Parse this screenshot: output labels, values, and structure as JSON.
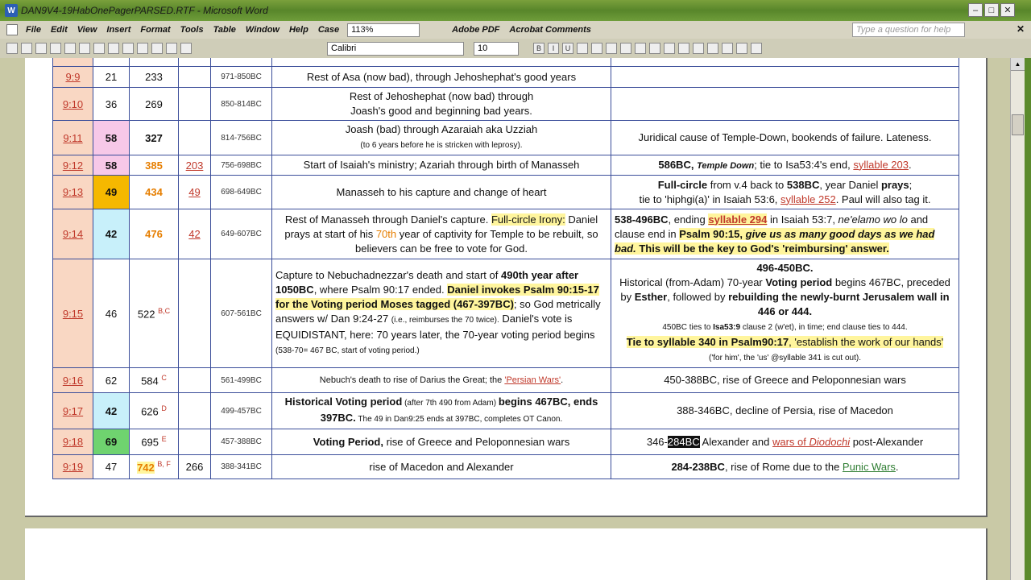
{
  "window": {
    "title": "DAN9V4-19HabOnePagerPARSED.RTF - Microsoft Word",
    "app_icon": "W"
  },
  "menu": {
    "items": [
      "File",
      "Edit",
      "View",
      "Insert",
      "Format",
      "Tools",
      "Table",
      "Window",
      "Help"
    ],
    "case_label": "Case",
    "zoom": "113%",
    "adobe": "Adobe PDF",
    "acrobat": "Acrobat Comments",
    "help_placeholder": "Type a question for help"
  },
  "toolbar": {
    "font": "Calibri",
    "size": "10"
  },
  "rows": [
    {
      "verse": "9:9",
      "c2": "21",
      "c3": "233",
      "c4": "",
      "dates": "971-850BC",
      "desc": "Rest of Asa (now bad), through Jehoshephat's good years",
      "notes": ""
    },
    {
      "verse": "9:10",
      "c2": "36",
      "c3": "269",
      "c4": "",
      "dates": "850-814BC",
      "desc_line1": "Rest of Jehoshephat (now bad) through",
      "desc_line2": "Joash's good and beginning bad years.",
      "notes": ""
    },
    {
      "verse": "9:11",
      "c2": "58",
      "c3": "327",
      "c4": "",
      "dates": "814-756BC",
      "desc_line1": "Joash (bad) through Azaraiah aka Uzziah",
      "desc_line2": "(to 6 years before he is stricken with leprosy).",
      "notes": "Juridical cause of Temple-Down, bookends of failure.  Lateness."
    },
    {
      "verse": "9:12",
      "c2": "58",
      "c3": "385",
      "c4": "203",
      "dates": "756-698BC",
      "desc": "Start of Isaiah's ministry; Azariah through birth of Manasseh",
      "notes_a": "586BC, ",
      "notes_b": "Temple Down",
      "notes_c": "; tie to Isa53:4's end, ",
      "notes_d": "syllable 203",
      "notes_e": "."
    },
    {
      "verse": "9:13",
      "c2": "49",
      "c3": "434",
      "c4": "49",
      "dates": "698-649BC",
      "desc": "Manasseh to his capture and change of heart",
      "notes_l1a": "Full-circle",
      "notes_l1b": " from v.4 back to ",
      "notes_l1c": "538BC",
      "notes_l1d": ", year Daniel ",
      "notes_l1e": "prays",
      "notes_l1f": ";",
      "notes_l2a": "tie to 'hiphgi(a)' in Isaiah 53:6, ",
      "notes_l2b": "syllable 252",
      "notes_l2c": ".  Paul will also tag it."
    },
    {
      "verse": "9:14",
      "c2": "42",
      "c3": "476",
      "c4": "42",
      "dates": "649-607BC",
      "desc_a": "Rest of Manasseh through Daniel's capture. ",
      "desc_b": "Full-circle Irony:",
      "desc_c": " Daniel prays at start of his ",
      "desc_d": "70th",
      "desc_e": " year of captivity for Temple to be rebuilt, so believers can be free to vote for God.",
      "notes_a": "538-496BC",
      "notes_b": ", ending ",
      "notes_c": "syllable 294",
      "notes_d": " in Isaiah 53:7, ",
      "notes_e": "ne'elamo wo lo",
      "notes_f": " and clause end in  ",
      "notes_g": "Psalm 90:15, ",
      "notes_h": "give us as many good days as we had bad.",
      "notes_i": "  This will be the key to God's 'reimbursing' answer."
    },
    {
      "verse": "9:15",
      "c2": "46",
      "c3": "522",
      "c3sup": "B,C",
      "c4": "",
      "dates": "607-561BC",
      "desc_a": "Capture to Nebuchadnezzar's death and start of ",
      "desc_b": "490th year after 1050BC",
      "desc_c": ", where Psalm 90:17 ended.  ",
      "desc_d": "Daniel invokes Psalm 90:15-17 for the Voting period Moses tagged (467-397BC)",
      "desc_e": "; so God metrically answers w/ Dan 9:24-27 ",
      "desc_f": "(i.e., reimburses the 70 twice).",
      "desc_g": " Daniel's vote is EQUIDISTANT, here:  70 years later, the 70-year voting period begins ",
      "desc_h": "(538-70= 467 BC, start of voting period.)",
      "notes_a": "496-450BC.",
      "notes_b": "Historical (from-Adam) 70-year ",
      "notes_c": "Voting period",
      "notes_d": " begins 467BC, preceded by ",
      "notes_e": "Esther",
      "notes_f": ", followed by ",
      "notes_g": "rebuilding the newly-burnt Jerusalem wall in 446 or 444.",
      "notes_h": "450BC ties to ",
      "notes_i": "Isa53:9",
      "notes_j": " clause 2 (w'et), in time; end clause ties to 444.",
      "notes_k": "Tie to syllable 340  in Psalm90:17",
      "notes_l": ", 'establish the work of our hands'",
      "notes_m": "('for him', the 'us' @syllable 341 is cut out)."
    },
    {
      "verse": "9:16",
      "c2": "62",
      "c3": "584",
      "c3sup": "C",
      "c4": "",
      "dates": "561-499BC",
      "desc_a": "Nebuch's death to  rise of Darius the Great; the ",
      "desc_b": "'Persian Wars'",
      "desc_c": ".",
      "notes": "450-388BC, rise of Greece and Peloponnesian wars"
    },
    {
      "verse": "9:17",
      "c2": "42",
      "c3": "626",
      "c3sup": "D",
      "c4": "",
      "dates": "499-457BC",
      "desc_a": "Historical Voting period",
      "desc_b": " (after 7th 490 from Adam) ",
      "desc_c": "begins 467BC, ends 397BC.",
      "desc_d": "  The 49 in Dan9:25 ends at 397BC, completes OT Canon.",
      "notes": "388-346BC,  decline of Persia, rise of Macedon"
    },
    {
      "verse": "9:18",
      "c2": "69",
      "c3": "695",
      "c3sup": "E",
      "c4": "",
      "dates": "457-388BC",
      "desc_a": "Voting Period,",
      "desc_b": " rise of Greece and Peloponnesian wars",
      "notes_a": "346-",
      "notes_b": "284BC",
      "notes_c": " Alexander and ",
      "notes_d": "wars of ",
      "notes_e": "Diodochi",
      "notes_f": " post-Alexander"
    },
    {
      "verse": "9:19",
      "c2": "47",
      "c3": "742",
      "c3sup": "B, F",
      "c4": "266",
      "dates": "388-341BC",
      "desc": "rise of Macedon and Alexander",
      "notes_a": "284-238BC",
      "notes_b": ", rise of Rome due to the ",
      "notes_c": "Punic Wars",
      "notes_d": "."
    }
  ],
  "colors": {
    "pink": "#f7c8e8",
    "gold": "#f5b800",
    "cyan": "#c8f0fa",
    "green": "#6fd36f"
  }
}
